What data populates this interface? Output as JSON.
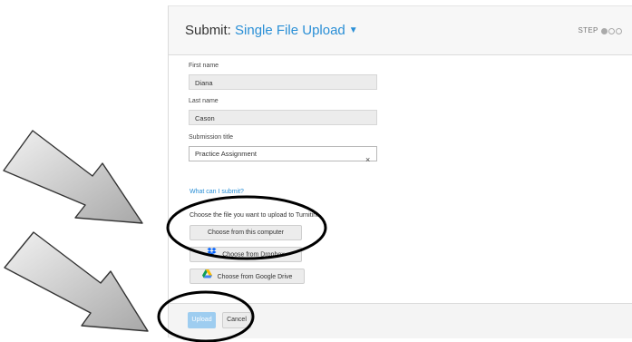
{
  "header": {
    "title_prefix": "Submit:",
    "title_type": "Single File Upload",
    "step_label": "STEP"
  },
  "form": {
    "first_name_label": "First name",
    "first_name_value": "Diana",
    "last_name_label": "Last name",
    "last_name_value": "Cason",
    "submission_title_label": "Submission title",
    "submission_title_value": "Practice Assignment",
    "clear_glyph": "×",
    "what_can_i_submit": "What can I submit?",
    "choose_prompt": "Choose the file you want to upload to Turnitin:"
  },
  "upload_options": {
    "computer_label": "Choose from this computer",
    "dropbox_label": "Choose from Dropbox",
    "google_drive_label": "Choose from Google Drive"
  },
  "footer": {
    "upload_label": "Upload",
    "cancel_label": "Cancel"
  },
  "steps": {
    "current": 1,
    "total": 3
  },
  "icons": [
    "caret-down-icon",
    "clear-icon",
    "dropbox-icon",
    "google-drive-icon",
    "arrow-icon"
  ],
  "colors": {
    "accent": "#2a8fd6",
    "upload_button": "#9ecdf0",
    "dropbox": "#0061fe"
  }
}
